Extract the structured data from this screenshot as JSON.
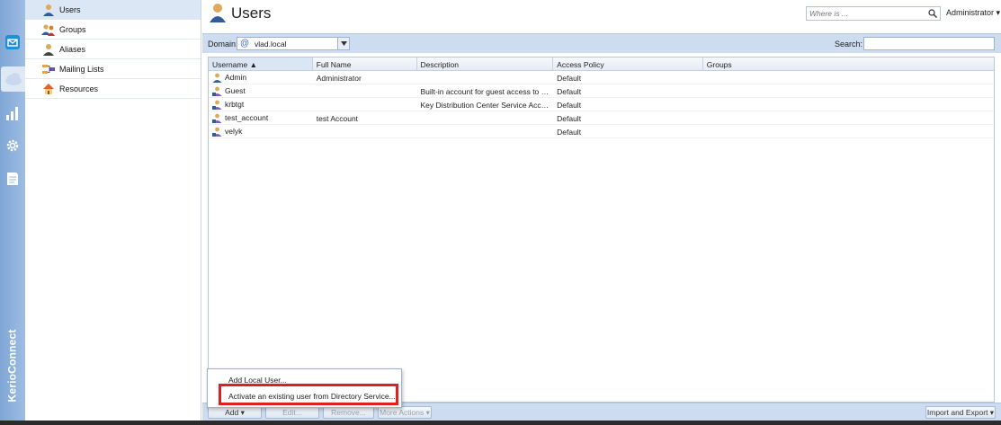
{
  "brand": {
    "name": "KerioConnect"
  },
  "rail": {
    "icons": [
      "mail-icon",
      "users-cloud-icon",
      "status-icon",
      "settings-icon",
      "logs-icon"
    ]
  },
  "sidebar": {
    "items": [
      {
        "label": "Users",
        "icon": "user-icon",
        "selected": true
      },
      {
        "label": "Groups",
        "icon": "group-icon",
        "selected": false
      },
      {
        "label": "Aliases",
        "icon": "alias-icon",
        "selected": false
      },
      {
        "label": "Mailing Lists",
        "icon": "mailing-list-icon",
        "selected": false
      },
      {
        "label": "Resources",
        "icon": "resource-icon",
        "selected": false
      }
    ]
  },
  "header": {
    "title": "Users",
    "where_placeholder": "Where is ...",
    "admin_label": "Administrator ▾"
  },
  "toolbar": {
    "domain_label": "Domain:",
    "domain_value": "vlad.local",
    "search_label": "Search:",
    "search_value": ""
  },
  "grid": {
    "columns": [
      "Username ▲",
      "Full Name",
      "Description",
      "Access Policy",
      "Groups"
    ],
    "rows": [
      {
        "username": "Admin",
        "fullname": "Administrator",
        "description": "",
        "policy": "Default",
        "groups": "",
        "icon": "admin-user-icon"
      },
      {
        "username": "Guest",
        "fullname": "",
        "description": "Built-in account for guest access to the...",
        "policy": "Default",
        "groups": "",
        "icon": "directory-user-icon"
      },
      {
        "username": "krbtgt",
        "fullname": "",
        "description": "Key Distribution Center Service Account",
        "policy": "Default",
        "groups": "",
        "icon": "directory-user-icon"
      },
      {
        "username": "test_account",
        "fullname": "test Account",
        "description": "",
        "policy": "Default",
        "groups": "",
        "icon": "directory-user-icon"
      },
      {
        "username": "velyk",
        "fullname": "",
        "description": "",
        "policy": "Default",
        "groups": "",
        "icon": "directory-user-icon"
      }
    ]
  },
  "bottom": {
    "add": "Add ▾",
    "edit": "Edit...",
    "remove": "Remove...",
    "more": "More Actions ▾",
    "import_export": "Import and Export ▾"
  },
  "add_menu": {
    "items": [
      "Add Local User...",
      "Activate an existing user from Directory Service..."
    ],
    "highlight_color": "#e02020"
  },
  "colors": {
    "rail": "#8fb1dc",
    "toolbar": "#cddcf0",
    "selected": "#dce7f5"
  }
}
